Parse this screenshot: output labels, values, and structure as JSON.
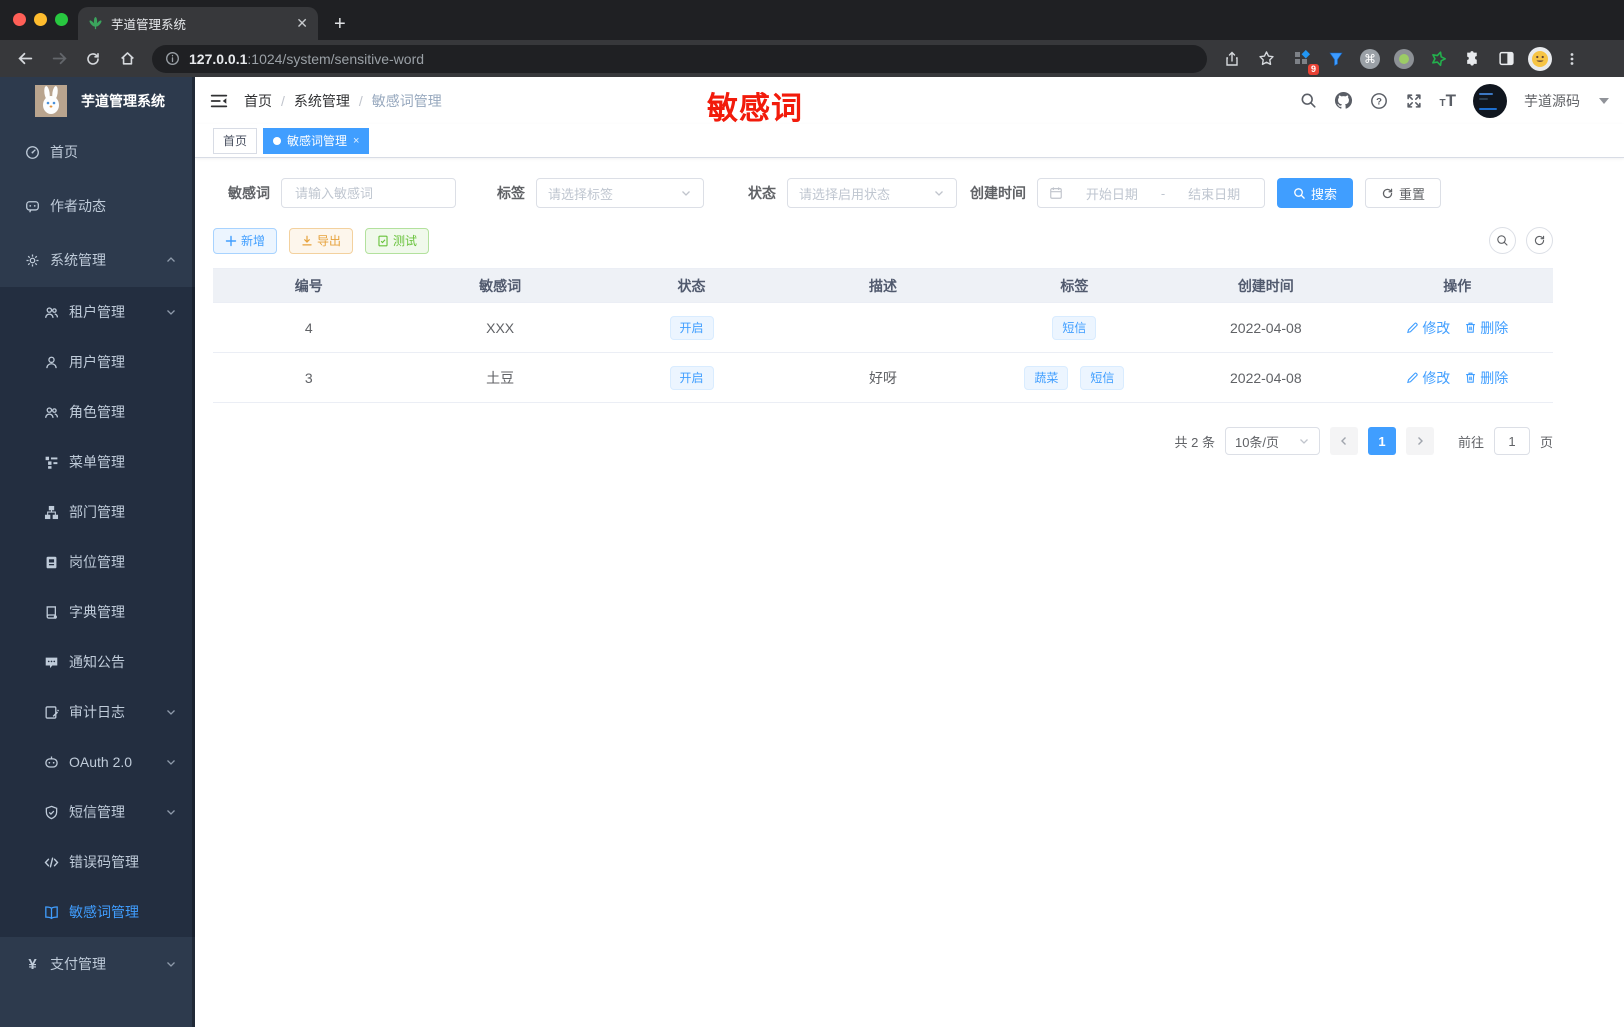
{
  "browser": {
    "tab_title": "芋道管理系统",
    "new_tab_label": "+",
    "url_host": "127.0.0.1",
    "url_rest": ":1024/system/sensitive-word",
    "extension_badge": "9"
  },
  "sidebar": {
    "app_title": "芋道管理系统",
    "items": [
      {
        "label": "首页"
      },
      {
        "label": "作者动态"
      },
      {
        "label": "系统管理"
      },
      {
        "label": "租户管理"
      },
      {
        "label": "用户管理"
      },
      {
        "label": "角色管理"
      },
      {
        "label": "菜单管理"
      },
      {
        "label": "部门管理"
      },
      {
        "label": "岗位管理"
      },
      {
        "label": "字典管理"
      },
      {
        "label": "通知公告"
      },
      {
        "label": "审计日志"
      },
      {
        "label": "OAuth 2.0"
      },
      {
        "label": "短信管理"
      },
      {
        "label": "错误码管理"
      },
      {
        "label": "敏感词管理"
      },
      {
        "label": "支付管理"
      }
    ]
  },
  "navbar": {
    "breadcrumb": {
      "home": "首页",
      "section": "系统管理",
      "current": "敏感词管理"
    },
    "separator": "/",
    "annotation": "敏感词",
    "username": "芋道源码"
  },
  "tags": {
    "home": "首页",
    "current": "敏感词管理",
    "close": "×"
  },
  "filters": {
    "keyword_label": "敏感词",
    "keyword_placeholder": "请输入敏感词",
    "tag_label": "标签",
    "tag_placeholder": "请选择标签",
    "status_label": "状态",
    "status_placeholder": "请选择启用状态",
    "date_label": "创建时间",
    "date_start_placeholder": "开始日期",
    "date_separator": "-",
    "date_end_placeholder": "结束日期",
    "search_label": "搜索",
    "reset_label": "重置"
  },
  "toolbar": {
    "add_label": "新增",
    "export_label": "导出",
    "test_label": "测试"
  },
  "table": {
    "headers": [
      "编号",
      "敏感词",
      "状态",
      "描述",
      "标签",
      "创建时间",
      "操作"
    ],
    "rows": [
      {
        "id": "4",
        "word": "XXX",
        "status": "开启",
        "desc": "",
        "tags": [
          "短信"
        ],
        "created": "2022-04-08"
      },
      {
        "id": "3",
        "word": "土豆",
        "status": "开启",
        "desc": "好呀",
        "tags": [
          "蔬菜",
          "短信"
        ],
        "created": "2022-04-08"
      }
    ],
    "edit_label": "修改",
    "delete_label": "删除"
  },
  "pagination": {
    "total": "共 2 条",
    "page_size": "10条/页",
    "current_page": "1",
    "goto_label": "前往",
    "goto_value": "1",
    "page_unit": "页"
  },
  "colors": {
    "accent": "#409eff",
    "warning": "#e6a23c",
    "success": "#67c23a",
    "annotation_red": "#f21b0b",
    "sidebar_bg": "#2d3a4d",
    "submenu_bg": "#232e40"
  }
}
